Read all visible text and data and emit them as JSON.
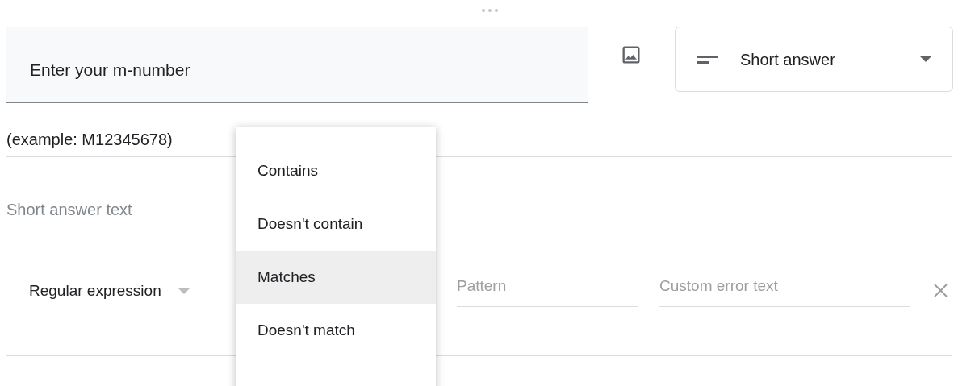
{
  "question": {
    "title": "Enter your m-number",
    "type": "Short answer",
    "description": "(example: M12345678)"
  },
  "answer_placeholder": "Short answer text",
  "validation": {
    "type": "Regular expression",
    "pattern_placeholder": "Pattern",
    "error_placeholder": "Custom error text"
  },
  "menu": [
    {
      "label": "Contains",
      "selected": false
    },
    {
      "label": "Doesn't contain",
      "selected": false
    },
    {
      "label": "Matches",
      "selected": true
    },
    {
      "label": "Doesn't match",
      "selected": false
    }
  ]
}
